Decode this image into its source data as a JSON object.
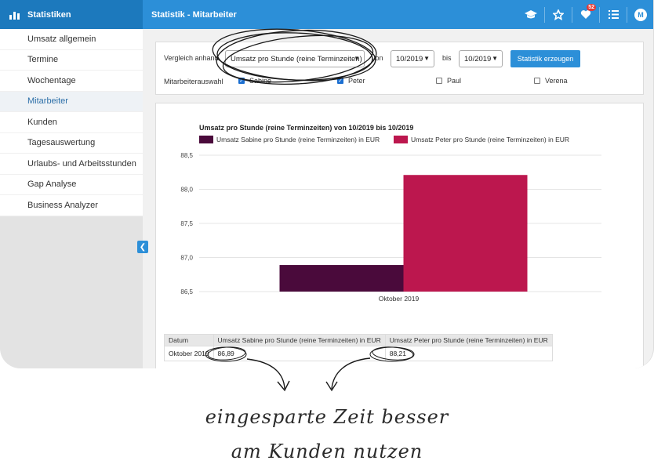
{
  "header": {
    "app_title": "Statistiken",
    "page_title": "Statistik - Mitarbeiter",
    "notification_count": "52",
    "avatar_initial": "M"
  },
  "sidebar": {
    "items": [
      {
        "label": "Umsatz allgemein"
      },
      {
        "label": "Termine"
      },
      {
        "label": "Wochentage"
      },
      {
        "label": "Mitarbeiter",
        "active": true
      },
      {
        "label": "Kunden"
      },
      {
        "label": "Tagesauswertung"
      },
      {
        "label": "Urlaubs- und Arbeitsstunden"
      },
      {
        "label": "Gap Analyse"
      },
      {
        "label": "Business Analyzer"
      }
    ]
  },
  "filter": {
    "compare_label": "Vergleich anhand",
    "compare_value": "Umsatz pro Stunde (reine Terminzeiten)",
    "from_label": "von",
    "from_value": "10/2019",
    "to_label": "bis",
    "to_value": "10/2019",
    "generate_button": "Statistik erzeugen",
    "employee_label": "Mitarbeiterauswahl",
    "employees": [
      {
        "name": "Sabine",
        "checked": true
      },
      {
        "name": "Peter",
        "checked": true
      },
      {
        "name": "Paul",
        "checked": false
      },
      {
        "name": "Verena",
        "checked": false
      }
    ]
  },
  "colors": {
    "sabine": "#4a0a3b",
    "peter": "#bc174e",
    "accent": "#2c8fd8"
  },
  "chart_data": {
    "type": "bar",
    "title": "Umsatz pro Stunde (reine Terminzeiten) von 10/2019 bis 10/2019",
    "categories": [
      "Oktober 2019"
    ],
    "series": [
      {
        "name": "Umsatz Sabine pro Stunde (reine Terminzeiten) in EUR",
        "values": [
          86.89
        ]
      },
      {
        "name": "Umsatz Peter pro Stunde (reine Terminzeiten) in EUR",
        "values": [
          88.21
        ]
      }
    ],
    "ylim": [
      86.5,
      88.5
    ],
    "yticks": [
      "88,5",
      "88,0",
      "87,5",
      "87,0",
      "86,5"
    ],
    "grid": true,
    "legend": "top"
  },
  "table": {
    "headers": [
      "Datum",
      "Umsatz Sabine pro Stunde (reine Terminzeiten) in EUR",
      "Umsatz Peter pro Stunde (reine Terminzeiten) in EUR"
    ],
    "rows": [
      [
        "Oktober 2019",
        "86,89",
        "88,21"
      ]
    ]
  },
  "annotation": {
    "line1": "eingesparte Zeit besser",
    "line2": "am Kunden nutzen"
  }
}
